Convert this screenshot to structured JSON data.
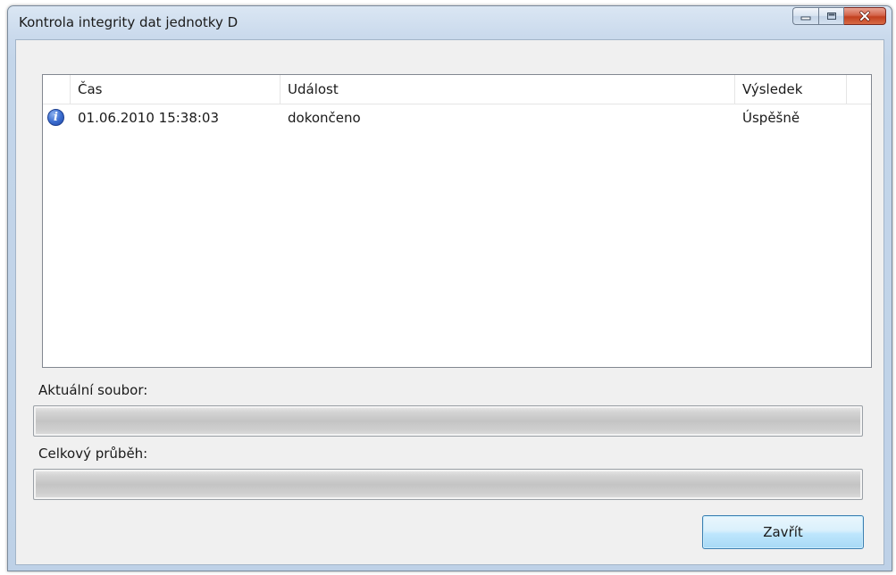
{
  "window": {
    "title": "Kontrola integrity dat jednotky D"
  },
  "list": {
    "columns": [
      "Čas",
      "Událost",
      "Výsledek"
    ],
    "rows": [
      {
        "icon": "info-icon",
        "time": "01.06.2010 15:38:03",
        "event": "dokončeno",
        "result": "Úspěšně"
      }
    ]
  },
  "progress": {
    "current_file_label": "Aktuální soubor:",
    "current_file_value": 0,
    "total_label": "Celkový průběh:",
    "total_value": 0
  },
  "buttons": {
    "close_label": "Zavřít"
  },
  "colors": {
    "progress_fill": "#38c03a",
    "title_bar": "#c9d9ec",
    "close_button_red": "#c2401f"
  }
}
